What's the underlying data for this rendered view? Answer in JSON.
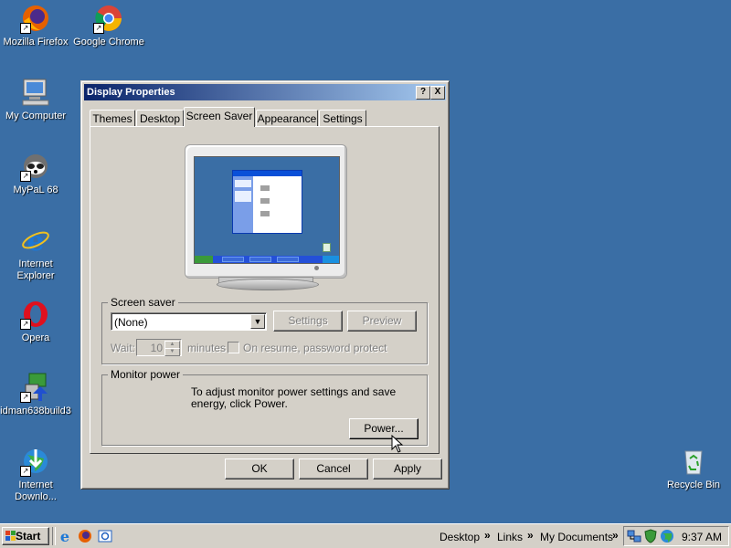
{
  "desktop": {
    "icons": [
      {
        "label": "Mozilla Firefox"
      },
      {
        "label": "Google Chrome"
      },
      {
        "label": "My Computer"
      },
      {
        "label": "MyPaL 68"
      },
      {
        "label": "Internet Explorer"
      },
      {
        "label": "Opera"
      },
      {
        "label": "idman638build3"
      },
      {
        "label": "Internet Downlo..."
      },
      {
        "label": "Recycle Bin"
      }
    ]
  },
  "window": {
    "title": "Display Properties",
    "help_btn": "?",
    "close_btn": "X",
    "tabs": [
      "Themes",
      "Desktop",
      "Screen Saver",
      "Appearance",
      "Settings"
    ],
    "active_tab": "Screen Saver",
    "screensaver": {
      "group_label": "Screen saver",
      "selected": "(None)",
      "settings_btn": "Settings",
      "preview_btn": "Preview",
      "wait_label": "Wait:",
      "wait_value": "10",
      "minutes_label": "minutes",
      "resume_label": "On resume, password protect"
    },
    "monitor_power": {
      "group_label": "Monitor power",
      "text": "To adjust monitor power settings and save energy, click Power.",
      "power_btn": "Power..."
    },
    "buttons": {
      "ok": "OK",
      "cancel": "Cancel",
      "apply": "Apply"
    }
  },
  "taskbar": {
    "start": "Start",
    "toolbars": [
      "Desktop",
      "Links",
      "My Documents"
    ],
    "clock": "9:37 AM"
  },
  "colors": {
    "desktop": "#3a6ea5",
    "title_start": "#0a246a",
    "title_end": "#a6caf0",
    "face": "#d4d0c8"
  }
}
